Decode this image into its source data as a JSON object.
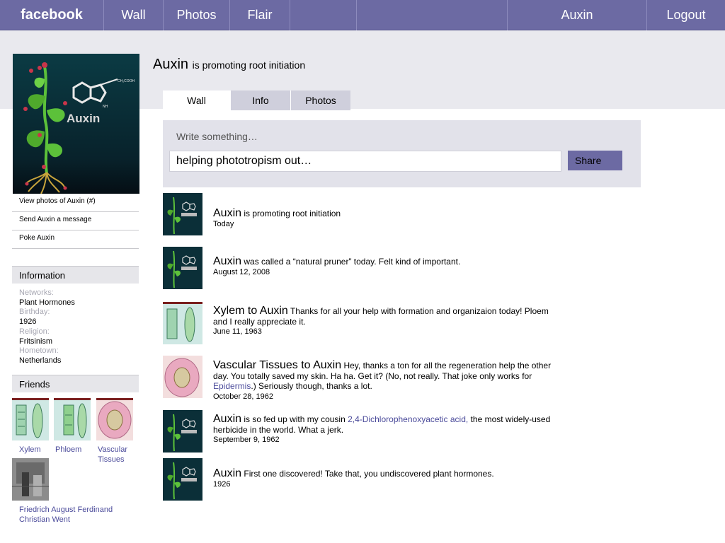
{
  "topbar": {
    "logo": "facebook",
    "nav": [
      "Wall",
      "Photos",
      "Flair"
    ],
    "user": "Auxin",
    "logout": "Logout"
  },
  "profile": {
    "name": "Auxin",
    "status": "is promoting root initiation",
    "pic_label": "Auxin",
    "pic_formula": "CH₂COOH",
    "pic_nh": "NH",
    "links": [
      "View photos of Auxin (#)",
      "Send Auxin a message",
      "Poke Auxin"
    ]
  },
  "information": {
    "heading": "Information",
    "rows": [
      {
        "k": "Networks:",
        "v": "Plant Hormones"
      },
      {
        "k": "Birthday:",
        "v": "1926"
      },
      {
        "k": "Religion:",
        "v": "Fritsinism"
      },
      {
        "k": "Hometown:",
        "v": "Netherlands"
      }
    ]
  },
  "friends": {
    "heading": "Friends",
    "items": [
      "Xylem",
      "Phloem",
      "Vascular Tissues",
      "Friedrich August Ferdinand Christian Went"
    ]
  },
  "tabs": [
    "Wall",
    "Info",
    "Photos"
  ],
  "composer": {
    "hint": "Write something…",
    "value": "helping phototropism out…",
    "share": "Share"
  },
  "posts": [
    {
      "who": "Auxin",
      "text": "is promoting root initiation",
      "date": "Today"
    },
    {
      "who": "Auxin",
      "text": "was called a “natural pruner” today. Felt kind of important.",
      "date": "August 12, 2008"
    },
    {
      "who": "Xylem to Auxin",
      "text": "Thanks for all your help with formation and organizaion today! Ploem and I really appreciate it.",
      "date": "June 11, 1963"
    },
    {
      "who": "Vascular Tissues to Auxin",
      "text_a": "Hey, thanks a ton for all the regeneration help the other day. You totally saved my skin. Ha ha. Get it? (No, not really. That joke only works for",
      "link": "Epidermis",
      "text_b": ".) Seriously though, thanks a lot.",
      "date": "October 28, 1962"
    },
    {
      "who": "Auxin",
      "text_a": "is so fed up with my cousin",
      "link": "2,4-Dichlorophenoxyacetic acid,",
      "text_b": "the most widely-used herbicide in the world. What a jerk.",
      "date": "September 9, 1962"
    },
    {
      "who": "Auxin",
      "text": "First one discovered! Take that, you undiscovered plant hormones.",
      "date": "1926"
    }
  ],
  "colors": {
    "brand": "#6c6aa3",
    "link": "#4a4a9a"
  }
}
